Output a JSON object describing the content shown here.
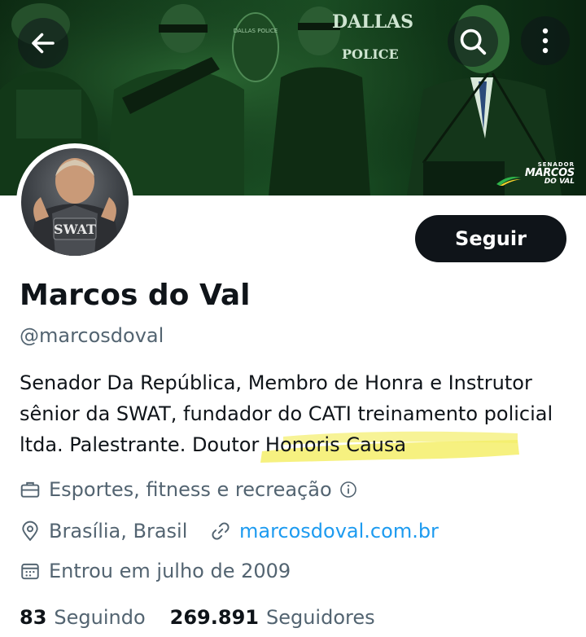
{
  "profile": {
    "name": "Marcos do Val",
    "handle": "@marcosdoval",
    "avatar_text": "SWAT",
    "bio_main": "Senador Da República, Membro de Honra e Instrutor sênior da SWAT, fundador do CATI treinamento policial ltda. Palestrante",
    "bio_highlight": ". Doutor Honoris Causa",
    "category": "Esportes, fitness e recreação",
    "location": "Brasília, Brasil",
    "website": "marcosdoval.com.br",
    "joined": "Entrou em julho de 2009",
    "following_count": "83",
    "following_label": "Seguindo",
    "followers_count": "269.891",
    "followers_label": "Seguidores"
  },
  "banner": {
    "police_text_1": "DALLAS",
    "police_text_2": "POLICE",
    "badge_text": "DALLAS POLICE",
    "logo_line1": "SENADOR",
    "logo_line2": "MARCOS",
    "logo_line3": "DO VAL"
  },
  "actions": {
    "follow_label": "Seguir"
  },
  "icons": {
    "back": "arrow-left-icon",
    "search": "search-icon",
    "more": "more-vertical-icon",
    "category": "briefcase-icon",
    "info": "info-icon",
    "location": "location-pin-icon",
    "link": "link-icon",
    "calendar": "calendar-icon"
  },
  "colors": {
    "accent": "#1d9bf0",
    "text_primary": "#0f1419",
    "text_secondary": "#536471",
    "highlight": "#f4ee6a"
  }
}
